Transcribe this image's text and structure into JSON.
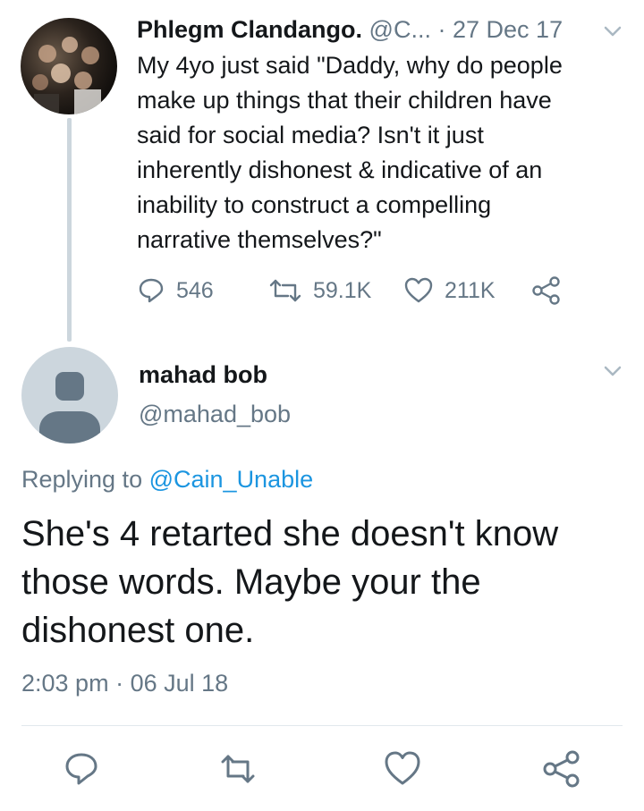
{
  "parent_tweet": {
    "author_name": "Phlegm Clandango.",
    "handle": "@C...",
    "separator": "·",
    "date": "27 Dec 17",
    "text": "My 4yo just said \"Daddy, why do  people\nmake up things that their children have\nsaid for social media? Isn't it just\ninherently dishonest & indicative of an\ninability to construct a compelling\nnarrative themselves?\"",
    "replies": "546",
    "retweets": "59.1K",
    "likes": "211K"
  },
  "reply_tweet": {
    "author_name": "mahad bob",
    "handle": "@mahad_bob",
    "replying_prefix": "Replying to",
    "replying_handle": "@Cain_Unable",
    "text": "She's 4 retarted she doesn't know those words. Maybe your the dishonest one.",
    "time": "2:03 pm",
    "separator": "·",
    "date": "06 Jul 18"
  },
  "icons": {
    "chevron": "chevron-down-icon",
    "reply": "reply-icon",
    "retweet": "retweet-icon",
    "like": "heart-icon",
    "share": "share-icon",
    "default_avatar": "default-avatar-icon"
  },
  "colors": {
    "text": "#14171a",
    "secondary": "#657786",
    "link": "#1b95e0",
    "thread_line": "#ccd6dd",
    "default_avatar_bg": "#ccd6dd",
    "default_avatar_fg": "#657786"
  }
}
